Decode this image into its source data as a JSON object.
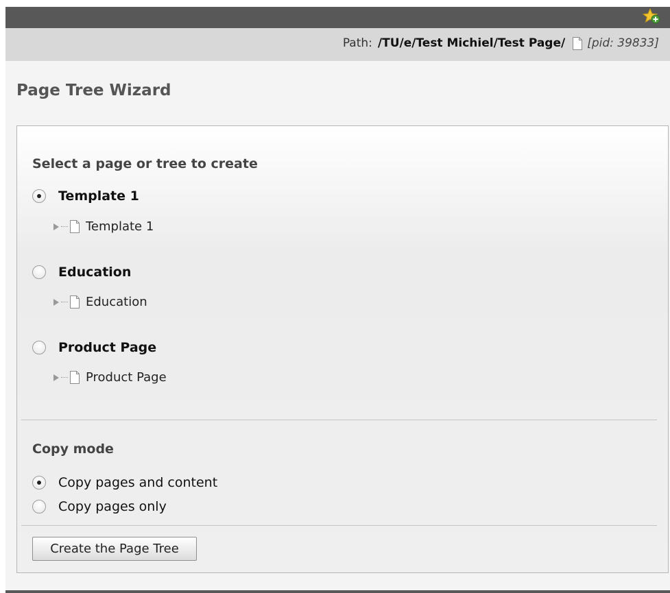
{
  "path_bar": {
    "label": "Path:",
    "value": "/TU/e/Test Michiel/Test Page/",
    "pid": "[pid: 39833]"
  },
  "page_title": "Page Tree Wizard",
  "select_section": {
    "title": "Select a page or tree to create",
    "options": [
      {
        "label": "Template 1",
        "checked": true,
        "tree_label": "Template 1"
      },
      {
        "label": "Education",
        "checked": false,
        "tree_label": "Education"
      },
      {
        "label": "Product Page",
        "checked": false,
        "tree_label": "Product Page"
      }
    ]
  },
  "copy_mode": {
    "title": "Copy mode",
    "options": [
      {
        "label": "Copy pages and content",
        "checked": true
      },
      {
        "label": "Copy pages only",
        "checked": false
      }
    ]
  },
  "create_button_label": "Create the Page Tree",
  "icons": {
    "bookmark": "star-add-icon",
    "page": "page-icon",
    "expand": "tree-expand-icon"
  },
  "colors": {
    "topbar": "#585858",
    "pathbar": "#d8d8d8",
    "title": "#555555"
  }
}
